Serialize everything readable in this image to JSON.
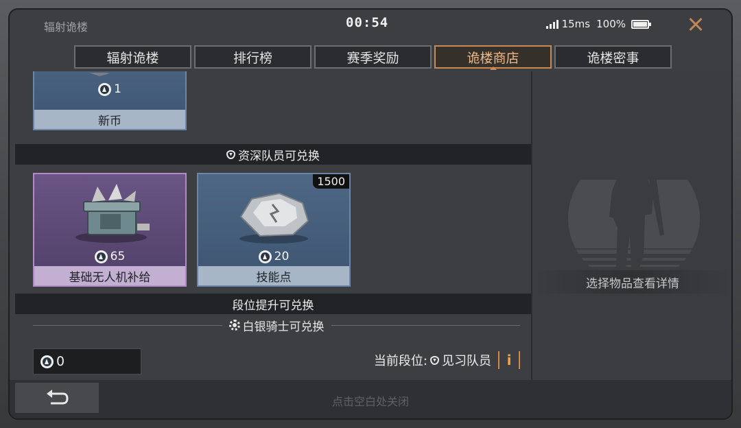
{
  "header": {
    "app_title": "辐射诡楼",
    "clock": "00:54",
    "ping": "15ms",
    "battery": "100%",
    "close_icon": "close-icon"
  },
  "tabs": [
    {
      "label": "辐射诡楼",
      "active": false
    },
    {
      "label": "排行榜",
      "active": false
    },
    {
      "label": "赛季奖励",
      "active": false
    },
    {
      "label": "诡楼商店",
      "active": true
    },
    {
      "label": "诡楼密事",
      "active": false
    }
  ],
  "shop": {
    "items_top": [
      {
        "name": "新币",
        "price": "1",
        "icon": "coin-bundle"
      }
    ],
    "section1_title": "资深队员可兑换",
    "items_mid": [
      {
        "name": "基础无人机补给",
        "price": "65",
        "badge": "",
        "rarity": "purple"
      },
      {
        "name": "技能点",
        "price": "20",
        "badge": "1500",
        "rarity": "blue"
      }
    ],
    "section2_title": "段位提升可兑换",
    "section3_title": "白银骑士可兑换",
    "balance": "0",
    "current_rank_label": "当前段位:",
    "current_rank_value": "见习队员",
    "info_label": "i"
  },
  "detail": {
    "placeholder": "选择物品查看详情"
  },
  "footer": {
    "hint": "点击空白处关闭",
    "back_icon": "back-arrow-icon"
  },
  "colors": {
    "accent": "#c98b55",
    "blue_card": "#4e6784",
    "purple_card": "#6a5585"
  }
}
